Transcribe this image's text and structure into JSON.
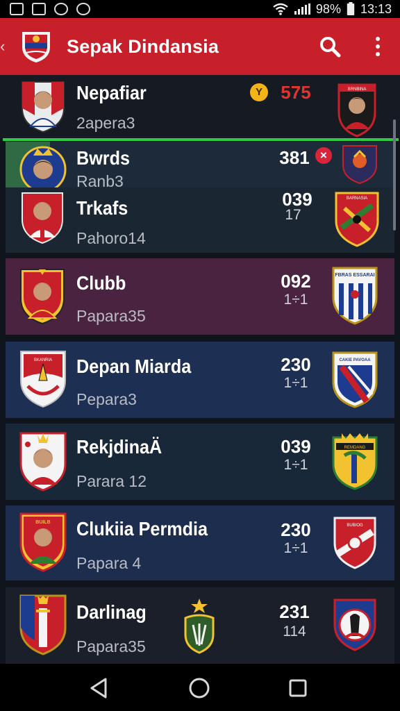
{
  "status_bar": {
    "battery": "98%",
    "time": "13:13"
  },
  "app_bar": {
    "title": "Sepak Dindansia",
    "back_glyph": "‹"
  },
  "clubs": [
    {
      "name": "Nepafiar",
      "sub": "2apera3",
      "score": "575",
      "score_color": "#e0342f",
      "badge": "Y",
      "badge_color": "#f2b417"
    },
    {
      "name": "Bwrds",
      "sub": "Ranb3",
      "score": "381",
      "badge": "×",
      "badge_color": "#d8253c"
    },
    {
      "name": "Trkafs",
      "sub": "Pahoro14",
      "score": "039",
      "score_sub": "17"
    },
    {
      "name": "Clubb",
      "sub": "Papara35",
      "score": "092",
      "score_sub": "1÷1"
    },
    {
      "name": "Depan Miarda",
      "sub": "Pepara3",
      "score": "230",
      "score_sub": "1÷1"
    },
    {
      "name": "RekjdinaÄ",
      "sub": "Parara 12",
      "score": "039",
      "score_sub": "1÷1"
    },
    {
      "name": "Clukiia Permdia",
      "sub": "Papara 4",
      "score": "230",
      "score_sub": "1÷1"
    },
    {
      "name": "Darlinag",
      "sub": "Papara35",
      "score": "231",
      "score_sub": "114"
    }
  ],
  "crest_texts": {
    "row1_right": "BRNBINA",
    "row3_right": "BARNASIA",
    "row4_right": "FBRAS ESSARAI",
    "row5_left": "BKANRIA",
    "row5_right": "CAKIE PAVOAA",
    "row6_right": "REMDANG",
    "row7_left": "BUILB",
    "row7_right": "BUBIOG"
  },
  "icons": [
    "image-icon",
    "gallery-icon",
    "compass-icon",
    "leaf-icon",
    "wifi-icon",
    "signal-icon",
    "battery-icon",
    "search-icon",
    "more-vert-icon",
    "back-icon",
    "home-icon",
    "recents-icon"
  ],
  "colors": {
    "app_bar": "#c8202a",
    "accent_green": "#2ecc40"
  }
}
